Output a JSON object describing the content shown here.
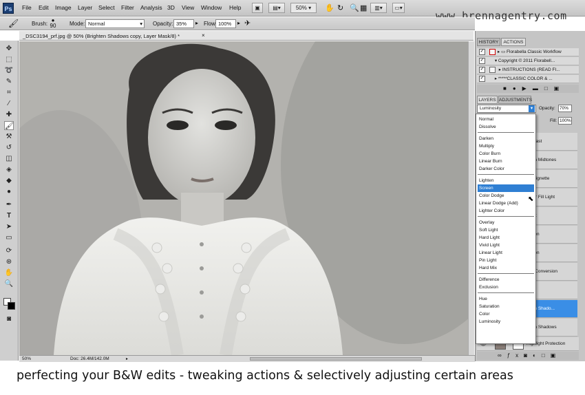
{
  "menubar": {
    "logo": "Ps",
    "items": [
      "File",
      "Edit",
      "Image",
      "Layer",
      "Select",
      "Filter",
      "Analysis",
      "3D",
      "View",
      "Window",
      "Help"
    ],
    "zoom_value": "50%",
    "watermark": "www.brennagentry.com"
  },
  "options": {
    "brush_label": "Brush:",
    "brush_size": "90",
    "mode_label": "Mode:",
    "mode_value": "Normal",
    "opacity_label": "Opacity:",
    "opacity_value": "35%",
    "flow_label": "Flow:",
    "flow_value": "100%"
  },
  "document": {
    "tab_title": "_DSC3194_prf.jpg @ 50% (Brighten Shadows copy, Layer Mask/8) *",
    "status_zoom": "50%",
    "status_doc": "Doc: 26.4M/142.0M"
  },
  "panels": {
    "top_tabs": [
      "HISTORY",
      "ACTIONS"
    ],
    "actions": [
      {
        "label": "Florabella Classic Workflow",
        "checked": true
      },
      {
        "label": "Copyright © 2011 Florabell...",
        "checked": true
      },
      {
        "label": "INSTRUCTIONS (READ FI...",
        "checked": true
      },
      {
        "label": "*****CLASSIC COLOR & ...",
        "checked": true
      }
    ],
    "mid_tabs": [
      "LAYERS",
      "ADJUSTMENTS"
    ],
    "blend_value": "Luminosity",
    "opacity_label": "Opacity:",
    "opacity_value": "70%",
    "fill_label": "Fill:",
    "fill_value": "100%",
    "layers": [
      {
        "label": "ntrast"
      },
      {
        "label": "ten Midtones"
      },
      {
        "label": "t Vignette"
      },
      {
        "label": "iter Fill Light"
      },
      {
        "label": "ast"
      },
      {
        "label": "nten"
      },
      {
        "label": "rken"
      },
      {
        "label": "V Conversion"
      },
      {
        "label": "en"
      },
      {
        "label": "ten Shado...",
        "selected": true
      },
      {
        "label": "ten Shadows"
      }
    ],
    "bottom_layer": "Highlight Protection"
  },
  "blend_modes": [
    {
      "label": "Normal"
    },
    {
      "label": "Dissolve"
    },
    {
      "sep": true
    },
    {
      "label": "Darken"
    },
    {
      "label": "Multiply"
    },
    {
      "label": "Color Burn"
    },
    {
      "label": "Linear Burn"
    },
    {
      "label": "Darker Color"
    },
    {
      "sep": true
    },
    {
      "label": "Lighten"
    },
    {
      "label": "Screen",
      "highlight": true
    },
    {
      "label": "Color Dodge"
    },
    {
      "label": "Linear Dodge (Add)"
    },
    {
      "label": "Lighter Color"
    },
    {
      "sep": true
    },
    {
      "label": "Overlay"
    },
    {
      "label": "Soft Light"
    },
    {
      "label": "Hard Light"
    },
    {
      "label": "Vivid Light"
    },
    {
      "label": "Linear Light"
    },
    {
      "label": "Pin Light"
    },
    {
      "label": "Hard Mix"
    },
    {
      "sep": true
    },
    {
      "label": "Difference"
    },
    {
      "label": "Exclusion"
    },
    {
      "sep": true
    },
    {
      "label": "Hue"
    },
    {
      "label": "Saturation"
    },
    {
      "label": "Color"
    },
    {
      "label": "Luminosity"
    }
  ],
  "caption": "perfecting your B&W edits - tweaking actions & selectively adjusting certain areas"
}
